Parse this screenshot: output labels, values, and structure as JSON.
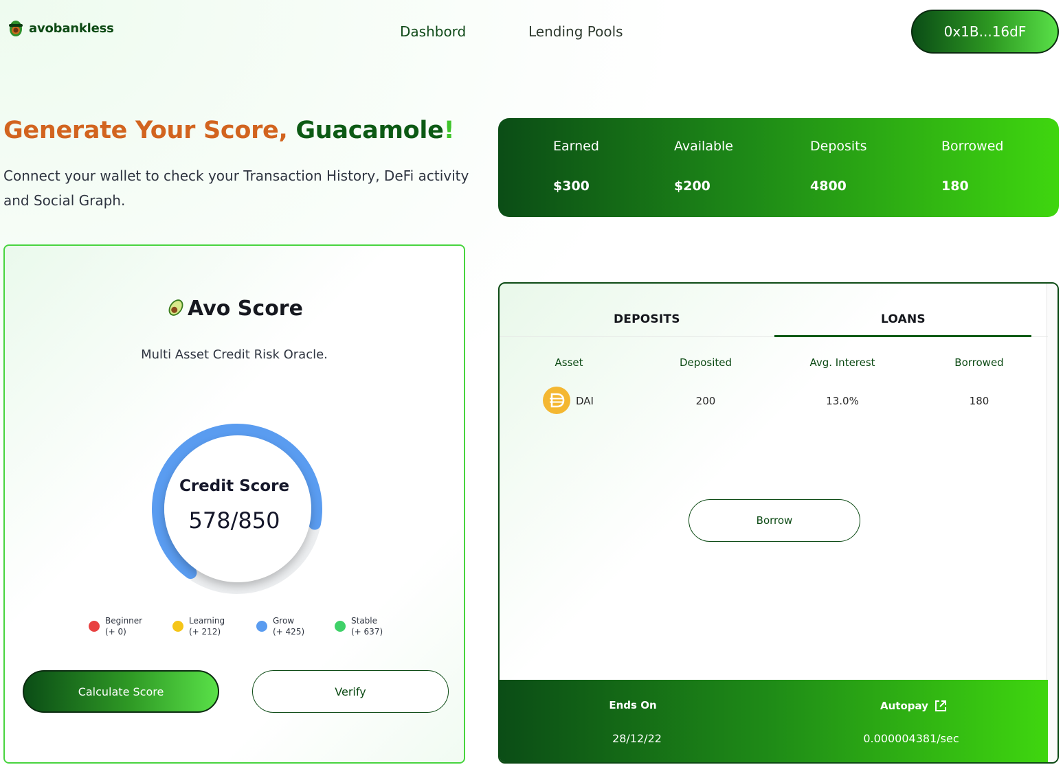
{
  "header": {
    "brand": "avobankless",
    "nav": [
      {
        "label": "Dashbord"
      },
      {
        "label": "Lending Pools"
      }
    ],
    "wallet_address": "0x1B...16dF"
  },
  "hero": {
    "title_part1": "Generate Your Score, ",
    "title_part2": "Guacamole",
    "title_bang": "!",
    "subtitle": "Connect your wallet to check your Transaction History, DeFi activity and Social Graph."
  },
  "stats": [
    {
      "label": "Earned",
      "value": "$300"
    },
    {
      "label": "Available",
      "value": "$200"
    },
    {
      "label": "Deposits",
      "value": "4800"
    },
    {
      "label": "Borrowed",
      "value": "180"
    }
  ],
  "score_card": {
    "title": "Avo Score",
    "subtitle": "Multi Asset Credit Risk Oracle.",
    "gauge_label": "Credit Score",
    "gauge_value": "578/850",
    "score": 578,
    "score_max": 850,
    "legend": [
      {
        "name": "Beginner",
        "threshold": "(+ 0)",
        "color": "#e84141"
      },
      {
        "name": "Learning",
        "threshold": "(+ 212)",
        "color": "#f5c518"
      },
      {
        "name": "Grow",
        "threshold": "(+ 425)",
        "color": "#5a9cf0"
      },
      {
        "name": "Stable",
        "threshold": "(+ 637)",
        "color": "#3fd168"
      }
    ],
    "gauge_color": "#5a9cf0",
    "calculate_label": "Calculate Score",
    "verify_label": "Verify"
  },
  "loans_card": {
    "tabs": [
      {
        "label": "DEPOSITS",
        "active": false
      },
      {
        "label": "LOANS",
        "active": true
      }
    ],
    "columns": [
      "Asset",
      "Deposited",
      "Avg. Interest",
      "Borrowed"
    ],
    "rows": [
      {
        "asset": "DAI",
        "icon": "dai-icon",
        "deposited": "200",
        "avg_interest": "13.0%",
        "borrowed": "180"
      }
    ],
    "borrow_label": "Borrow",
    "footer": {
      "ends_on_label": "Ends On",
      "ends_on_value": "28/12/22",
      "autopay_label": "Autopay",
      "autopay_value": "0.000004381/sec"
    }
  },
  "colors": {
    "brand_dark": "#0b4d16",
    "brand_light": "#3fd60f",
    "accent_orange": "#d2641f"
  }
}
